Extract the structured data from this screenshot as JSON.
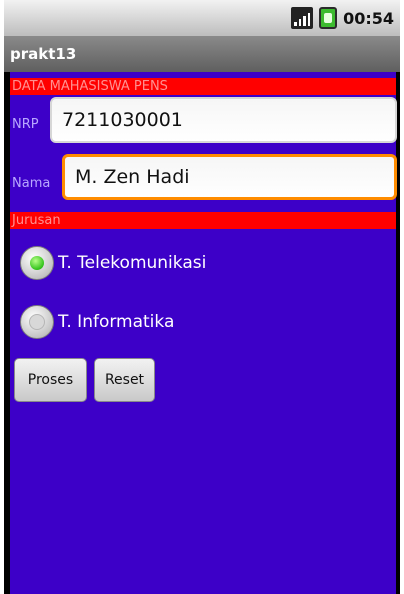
{
  "status": {
    "time": "00:54"
  },
  "app": {
    "title": "prakt13"
  },
  "form": {
    "header": "DATA MAHASISWA PENS",
    "nrp_label": "NRP",
    "nrp_value": "7211030001",
    "nama_label": "Nama",
    "nama_value": "M. Zen Hadi",
    "jurusan_header": "Jurusan",
    "options": [
      {
        "label": "T. Telekomunikasi",
        "selected": true
      },
      {
        "label": "T. Informatika",
        "selected": false
      }
    ],
    "buttons": {
      "proses": "Proses",
      "reset": "Reset"
    }
  },
  "colors": {
    "background": "#3d00c8",
    "header_bar": "#ff0000",
    "focus_border": "#ff8c00",
    "radio_selected": "#31c21a"
  },
  "icons": {
    "signal": "signal-icon",
    "battery": "battery-icon"
  }
}
